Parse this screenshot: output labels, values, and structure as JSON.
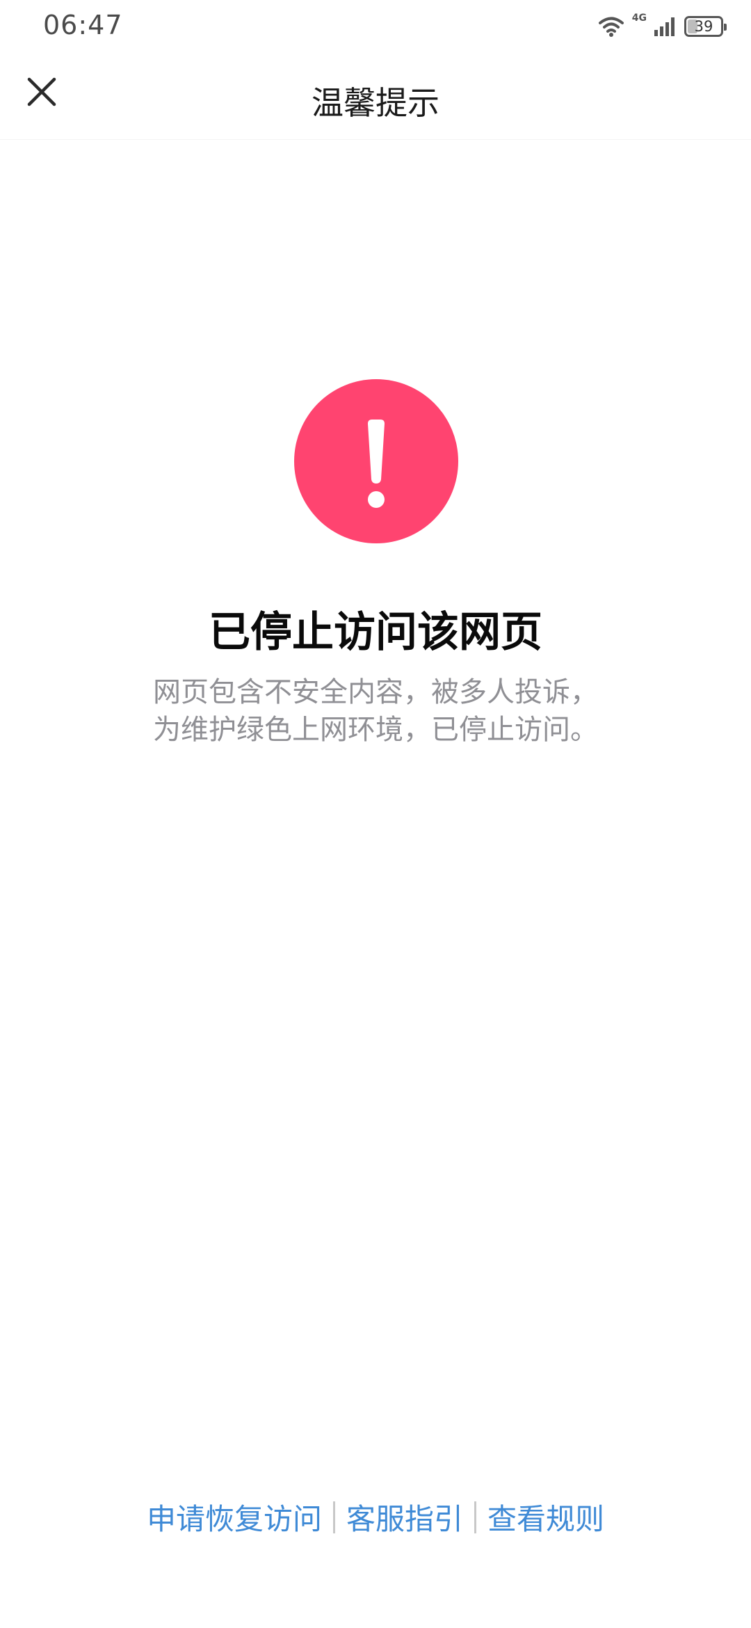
{
  "status_bar": {
    "time": "06:47",
    "network_label": "4G",
    "battery_level": "39",
    "icons": [
      "wifi-icon",
      "signal-icon",
      "battery-icon"
    ]
  },
  "header": {
    "title": "温馨提示",
    "close_icon": "close-icon"
  },
  "main": {
    "icon": "exclamation-circle-icon",
    "icon_color": "#ff4470",
    "title": "已停止访问该网页",
    "description_line1": "网页包含不安全内容，被多人投诉，",
    "description_line2": "为维护绿色上网环境，已停止访问。"
  },
  "footer": {
    "links": [
      {
        "label": "申请恢复访问"
      },
      {
        "label": "客服指引"
      },
      {
        "label": "查看规则"
      }
    ],
    "link_color": "#3f8ad6"
  }
}
